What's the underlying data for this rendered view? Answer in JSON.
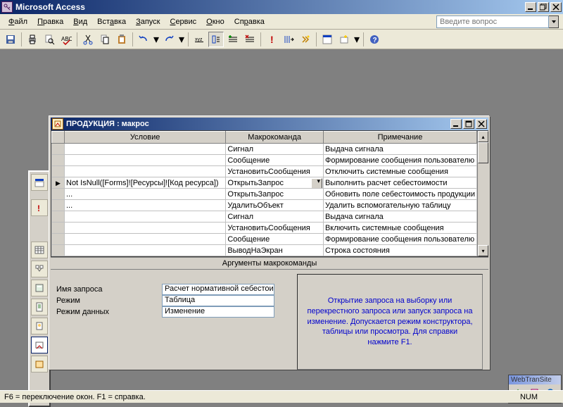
{
  "app_title": "Microsoft Access",
  "askbox_placeholder": "Введите вопрос",
  "menus": {
    "file": "Файл",
    "edit": "Правка",
    "view": "Вид",
    "insert": "Вставка",
    "run": "Запуск",
    "tools": "Сервис",
    "window": "Окно",
    "help": "Справка"
  },
  "macro_window_title": "ПРОДУКЦИЯ : макрос",
  "grid_headers": {
    "condition": "Условие",
    "action": "Макрокоманда",
    "comment": "Примечание"
  },
  "rows": [
    {
      "cond": "",
      "act": "Сигнал",
      "note": "Выдача сигнала"
    },
    {
      "cond": "",
      "act": "Сообщение",
      "note": "Формирование сообщения пользователю"
    },
    {
      "cond": "",
      "act": "УстановитьСообщения",
      "note": "Отключить системные сообщения"
    },
    {
      "cond": "Not IsNull([Forms]![Ресурсы]![Код ресурса])",
      "act": "ОткрытьЗапрос",
      "note": "Выполнить расчет себестоимости",
      "current": true,
      "dd": true
    },
    {
      "cond": "...",
      "act": "ОткрытьЗапрос",
      "note": "Обновить поле себестоимость продукции"
    },
    {
      "cond": "...",
      "act": "УдалитьОбъект",
      "note": "Удалить вспомогательную таблицу"
    },
    {
      "cond": "",
      "act": "Сигнал",
      "note": "Выдача сигнала"
    },
    {
      "cond": "",
      "act": "УстановитьСообщения",
      "note": "Включить системные сообщения"
    },
    {
      "cond": "",
      "act": "Сообщение",
      "note": "Формирование сообщения пользователю"
    },
    {
      "cond": "",
      "act": "ВыводНаЭкран",
      "note": "Строка состояния"
    }
  ],
  "args_title": "Аргументы макрокоманды",
  "args": {
    "query_name_label": "Имя запроса",
    "query_name_value": "Расчет нормативной себестоимости",
    "mode_label": "Режим",
    "mode_value": "Таблица",
    "data_mode_label": "Режим данных",
    "data_mode_value": "Изменение"
  },
  "help_text": "Открытие запроса на выборку или перекрестного запроса или запуск запроса на изменение. Допускается режим конструктора, таблицы или просмотра. Для справки нажмите F1.",
  "webtran_title": "WebTranSite",
  "status_left": "F6 = переключение окон.  F1 = справка.",
  "status_num": "NUM"
}
